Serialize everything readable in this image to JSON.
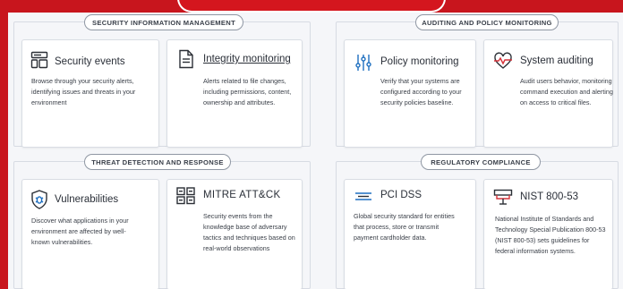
{
  "colors": {
    "frame": "#c8151d",
    "accent": "#1e6fc0",
    "icon_red": "#d6323a"
  },
  "sections": [
    {
      "title": "SECURITY INFORMATION MANAGEMENT",
      "cards": [
        {
          "title": "Security events",
          "icon": "dashboard-layout-icon",
          "desc": "Browse through your security alerts, identifying issues and threats in your environment"
        },
        {
          "title": "Integrity monitoring",
          "icon": "document-icon",
          "desc": "Alerts related to file changes, including permissions, content, ownership and attributes."
        }
      ]
    },
    {
      "title": "AUDITING AND POLICY MONITORING",
      "cards": [
        {
          "title": "Policy monitoring",
          "icon": "sliders-icon",
          "desc": "Verify that your systems are configured according to your security policies baseline."
        },
        {
          "title": "System auditing",
          "icon": "heart-pulse-icon",
          "desc": "Audit users behavior, monitoring command execution and alerting on access to critical files."
        }
      ]
    },
    {
      "title": "THREAT DETECTION AND RESPONSE",
      "cards": [
        {
          "title": "Vulnerabilities",
          "icon": "bug-shield-icon",
          "desc": "Discover what applications in your environment are affected by well-known vulnerabilities."
        },
        {
          "title": "MITRE ATT&CK",
          "icon": "matrix-grid-icon",
          "desc": "Security events from the knowledge base of adversary tactics and techniques based on real-world observations"
        }
      ]
    },
    {
      "title": "REGULATORY COMPLIANCE",
      "cards": [
        {
          "title": "PCI DSS",
          "icon": "card-stack-icon",
          "desc": "Global security standard for entities that process, store or transmit payment cardholder data."
        },
        {
          "title": "NIST 800-53",
          "icon": "monitor-icon",
          "desc": "National Institute of Standards and Technology Special Publication 800-53 (NIST 800-53) sets guidelines for federal information systems."
        }
      ]
    }
  ]
}
